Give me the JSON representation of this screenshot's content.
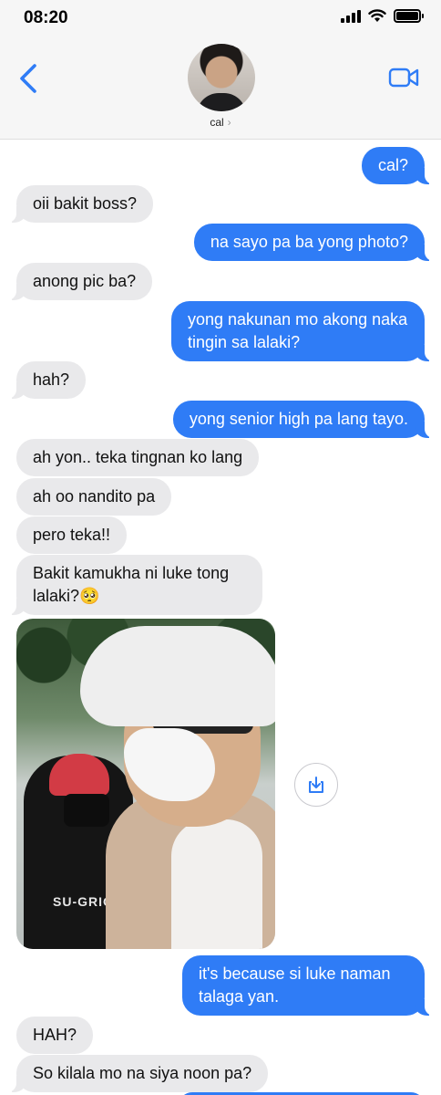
{
  "status": {
    "time": "08:20"
  },
  "contact": {
    "name": "cal"
  },
  "colors": {
    "sent": "#2f7cf6",
    "received": "#e9e9eb",
    "accent": "#2f7cf6"
  },
  "icons": {
    "back": "chevron-left-icon",
    "video": "video-camera-icon",
    "save": "download-icon"
  },
  "messages": [
    {
      "from": "me",
      "text": "cal?"
    },
    {
      "from": "them",
      "text": "oii bakit boss?"
    },
    {
      "from": "me",
      "text": "na sayo pa ba yong photo?"
    },
    {
      "from": "them",
      "text": "anong pic ba?"
    },
    {
      "from": "me",
      "text": "yong nakunan mo akong naka tingin sa lalaki?"
    },
    {
      "from": "them",
      "text": "hah?"
    },
    {
      "from": "me",
      "text": "yong senior high pa lang tayo."
    },
    {
      "from": "them",
      "text": "ah yon.. teka tingnan ko lang"
    },
    {
      "from": "them",
      "text": "ah oo nandito pa"
    },
    {
      "from": "them",
      "text": "pero teka!!"
    },
    {
      "from": "them",
      "text": "Bakit kamukha ni luke tong lalaki?🥺"
    },
    {
      "from": "them",
      "type": "photo"
    },
    {
      "from": "me",
      "text": "it's because si luke naman talaga yan."
    },
    {
      "from": "them",
      "text": "HAH?"
    },
    {
      "from": "them",
      "text": "So kilala mo na siya noon pa?"
    }
  ],
  "photo_text": "SU-GRIOS"
}
